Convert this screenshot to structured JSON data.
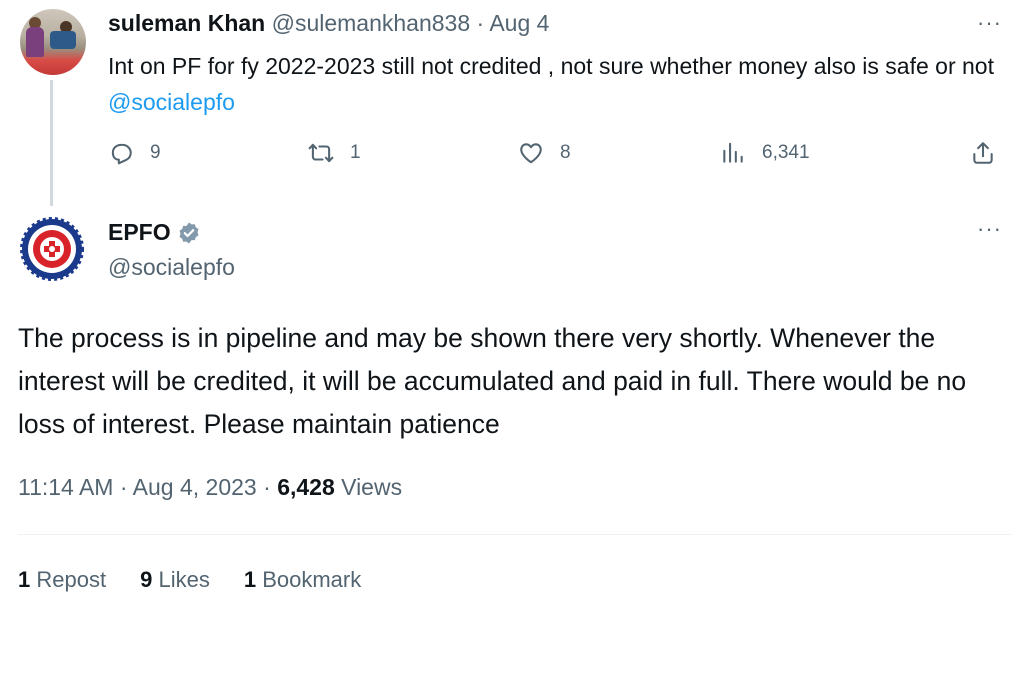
{
  "reply_tweet": {
    "author_name": "suleman Khan",
    "handle": "@sulemankhan838",
    "separator": "·",
    "date": "Aug 4",
    "text": "Int on PF for fy 2022-2023 still not credited , not sure whether money also is safe or not ",
    "mention": "@socialepfo",
    "more_label": "···",
    "counts": {
      "replies": "9",
      "reposts": "1",
      "likes": "8",
      "views": "6,341"
    },
    "icons": [
      "reply-icon",
      "repost-icon",
      "like-icon",
      "views-icon",
      "share-icon"
    ]
  },
  "main_tweet": {
    "author_name": "EPFO",
    "handle": "@socialepfo",
    "verified_badge_color": "#829aab",
    "more_label": "···",
    "text": "The process is in pipeline and may be shown there very shortly. Whenever the interest will be credited, it will be accumulated and paid in full. There would be no loss of interest. Please maintain patience",
    "time": "11:14 AM",
    "sep1": "·",
    "date": "Aug 4, 2023",
    "sep2": "·",
    "views_count": "6,428",
    "views_label": "Views",
    "stats": {
      "reposts_count": "1",
      "reposts_label": "Repost",
      "likes_count": "9",
      "likes_label": "Likes",
      "bookmarks_count": "1",
      "bookmarks_label": "Bookmark"
    }
  },
  "colors": {
    "text": "#0f1419",
    "secondary": "#536471",
    "link": "#1d9bf0",
    "thread_line": "#cfd9de",
    "epfo_blue": "#1b3a8c",
    "epfo_red": "#d8232a"
  }
}
